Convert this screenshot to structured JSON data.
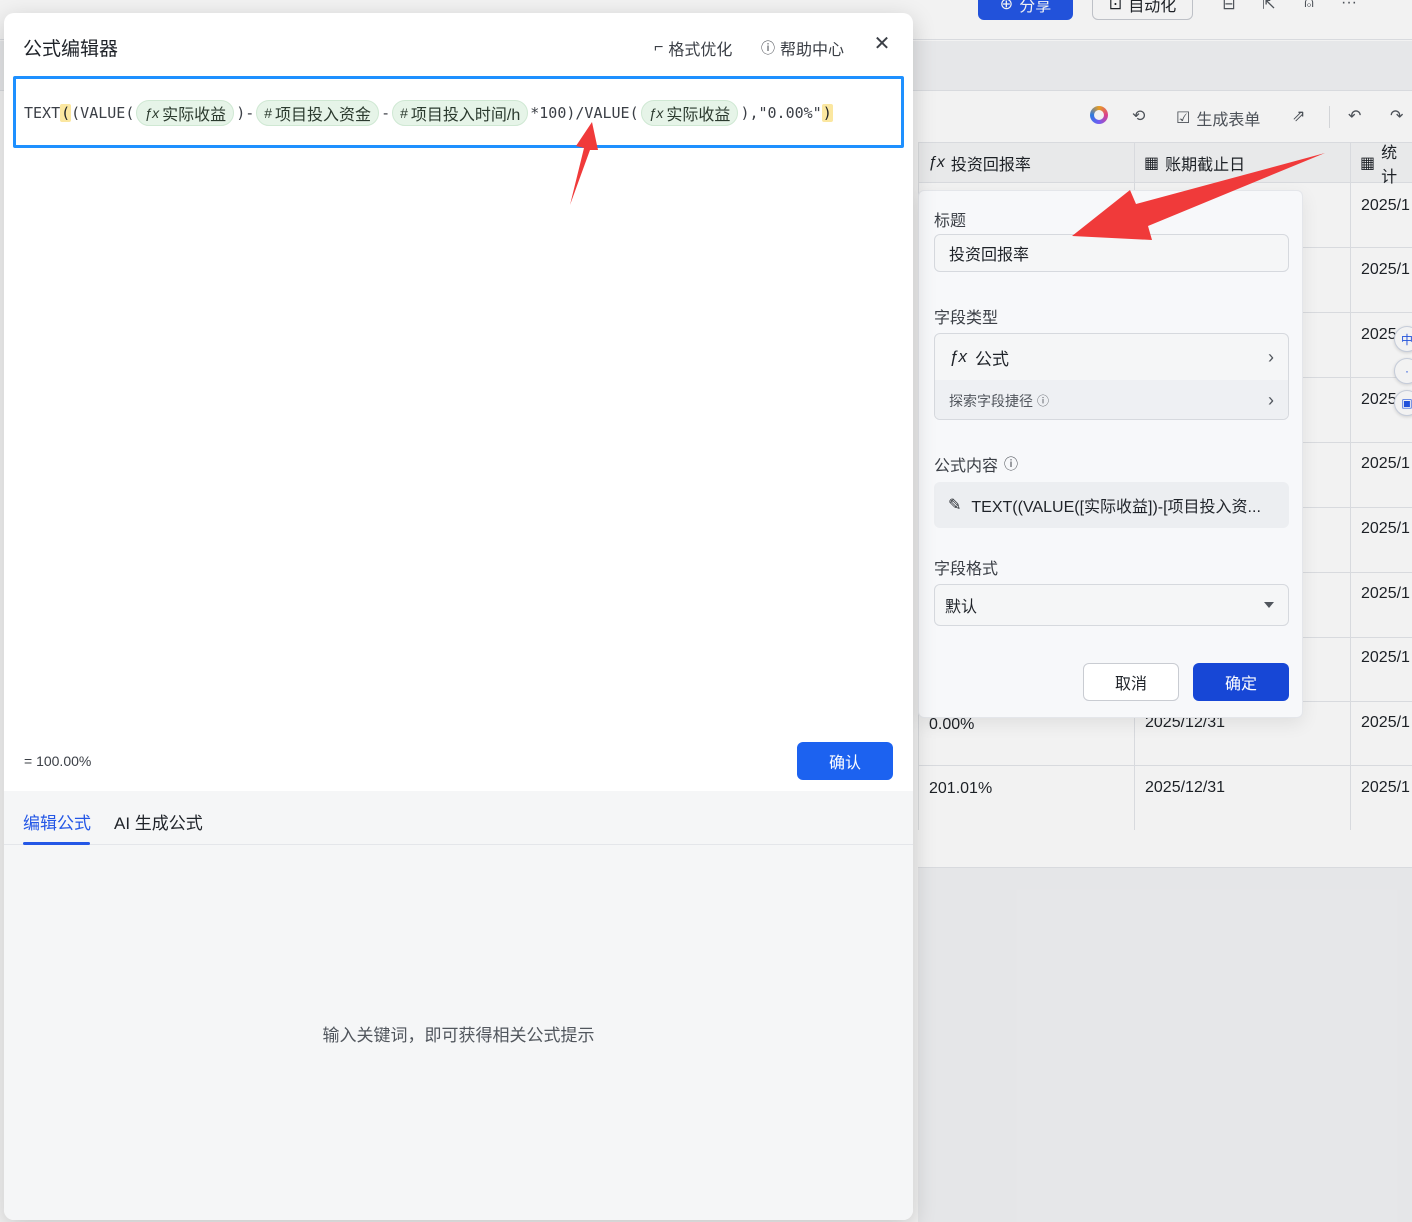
{
  "background": {
    "topbar": {
      "share_label": "分享",
      "automation_label": "自动化"
    },
    "toolbar": {
      "generate_form_label": "生成表单"
    },
    "table": {
      "columns": [
        "投资回报率",
        "账期截止日",
        "统计"
      ],
      "rows": [
        {
          "c1": "",
          "c2": "",
          "c3": "2025/1"
        },
        {
          "c1": "",
          "c2": "",
          "c3": "2025/1"
        },
        {
          "c1": "",
          "c2": "",
          "c3": "2025"
        },
        {
          "c1": "",
          "c2": "",
          "c3": "2025"
        },
        {
          "c1": "",
          "c2": "",
          "c3": "2025/1"
        },
        {
          "c1": "",
          "c2": "",
          "c3": "2025/1"
        },
        {
          "c1": "",
          "c2": "",
          "c3": "2025/1"
        },
        {
          "c1": "",
          "c2": "",
          "c3": "2025/1"
        },
        {
          "c1": "0.00%",
          "c2": "2025/12/31",
          "c3": "2025/1"
        },
        {
          "c1": "201.01%",
          "c2": "2025/12/31",
          "c3": "2025/1"
        }
      ]
    },
    "side_badge": "中"
  },
  "field_panel": {
    "title_label": "标题",
    "title_value": "投资回报率",
    "type_label": "字段类型",
    "type_value": "公式",
    "type_sub": "探索字段捷径",
    "formula_label": "公式内容",
    "formula_value": "TEXT((VALUE([实际收益])-[项目投入资...",
    "format_label": "字段格式",
    "format_value": "默认",
    "cancel_label": "取消",
    "ok_label": "确定"
  },
  "modal": {
    "title": "公式编辑器",
    "format_link": "格式优化",
    "help_link": "帮助中心",
    "formula": {
      "t1": "TEXT",
      "t2": "(",
      "t3": "(VALUE(",
      "chip1": "实际收益",
      "t4": ")-",
      "chip2": "项目投入资金",
      "t5": "-",
      "chip3": "项目投入时间/h",
      "t6": "*100)/VALUE(",
      "chip4": "实际收益",
      "t7": "),\"0.00%\"",
      "t8": ")"
    },
    "result": "= 100.00%",
    "confirm_label": "确认",
    "tabs": [
      "编辑公式",
      "AI 生成公式"
    ],
    "hint": "输入关键词，即可获得相关公式提示"
  },
  "colors": {
    "primary": "#1c62f0",
    "editor_border": "#1e90ff",
    "chip_bg": "#e6f4e8",
    "annotation": "#f03a3a"
  }
}
